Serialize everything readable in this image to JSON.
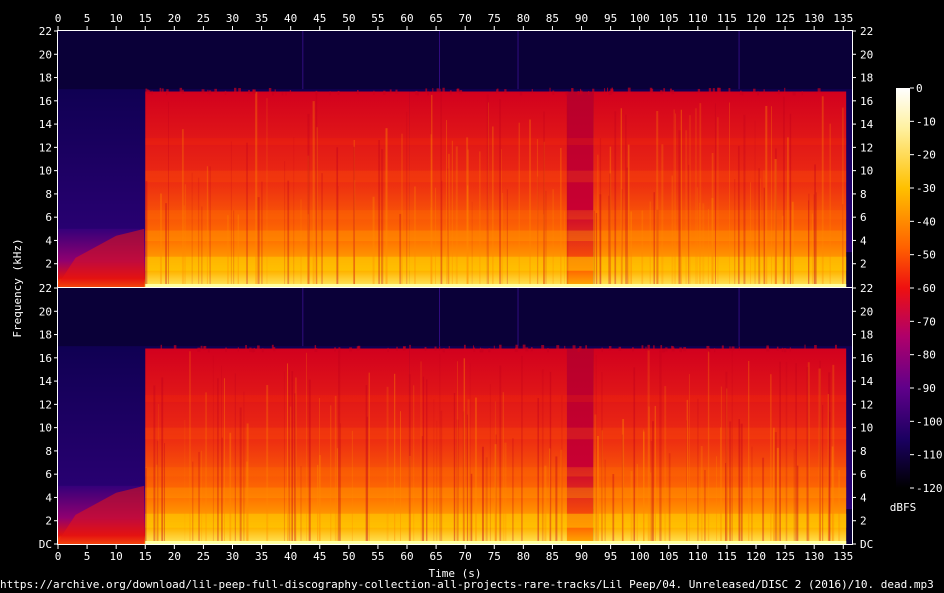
{
  "chart_data": {
    "type": "heatmap",
    "xlabel": "Time (s)",
    "ylabel": "Frequency (kHz)",
    "x_ticks": [
      0,
      5,
      10,
      15,
      20,
      25,
      30,
      35,
      40,
      45,
      50,
      55,
      60,
      65,
      70,
      75,
      80,
      85,
      90,
      95,
      100,
      105,
      110,
      115,
      120,
      125,
      130,
      135
    ],
    "xlim": [
      0,
      136.5
    ],
    "ylim_khz": [
      0,
      22
    ],
    "channels": [
      {
        "y_tick_labels": [
          "22",
          "20",
          "18",
          "16",
          "14",
          "12",
          "10",
          "8",
          "6",
          "4",
          "2"
        ]
      },
      {
        "y_tick_labels": [
          "22",
          "20",
          "18",
          "16",
          "14",
          "12",
          "10",
          "8",
          "6",
          "4",
          "2",
          "DC"
        ]
      }
    ],
    "y_tick_values": [
      22,
      20,
      18,
      16,
      14,
      12,
      10,
      8,
      6,
      4,
      2,
      0
    ],
    "colorbar": {
      "label": "dBFS",
      "ticks": [
        "0",
        "-10",
        "-20",
        "-30",
        "-40",
        "-50",
        "-60",
        "-70",
        "-80",
        "-90",
        "-100",
        "-110",
        "-120"
      ],
      "range": [
        -120,
        0
      ]
    },
    "description_segments": [
      {
        "from": 0,
        "to": 15,
        "cutoff_khz": 5,
        "level": "low intro"
      },
      {
        "from": 15,
        "to": 60.5,
        "cutoff_khz": 16.8,
        "level": "full"
      },
      {
        "from": 60.5,
        "to": 87.5,
        "cutoff_khz": 16.8,
        "level": "full"
      },
      {
        "from": 87.5,
        "to": 92,
        "cutoff_khz": 16.8,
        "level": "dip"
      },
      {
        "from": 92,
        "to": 135.5,
        "cutoff_khz": 16.8,
        "level": "full"
      }
    ]
  },
  "footer": {
    "source_path": "https://archive.org/download/lil-peep-full-discography-collection-all-projects-rare-tracks/Lil Peep/04. Unreleased/DISC 2 (2016)/10. dead.mp3"
  }
}
